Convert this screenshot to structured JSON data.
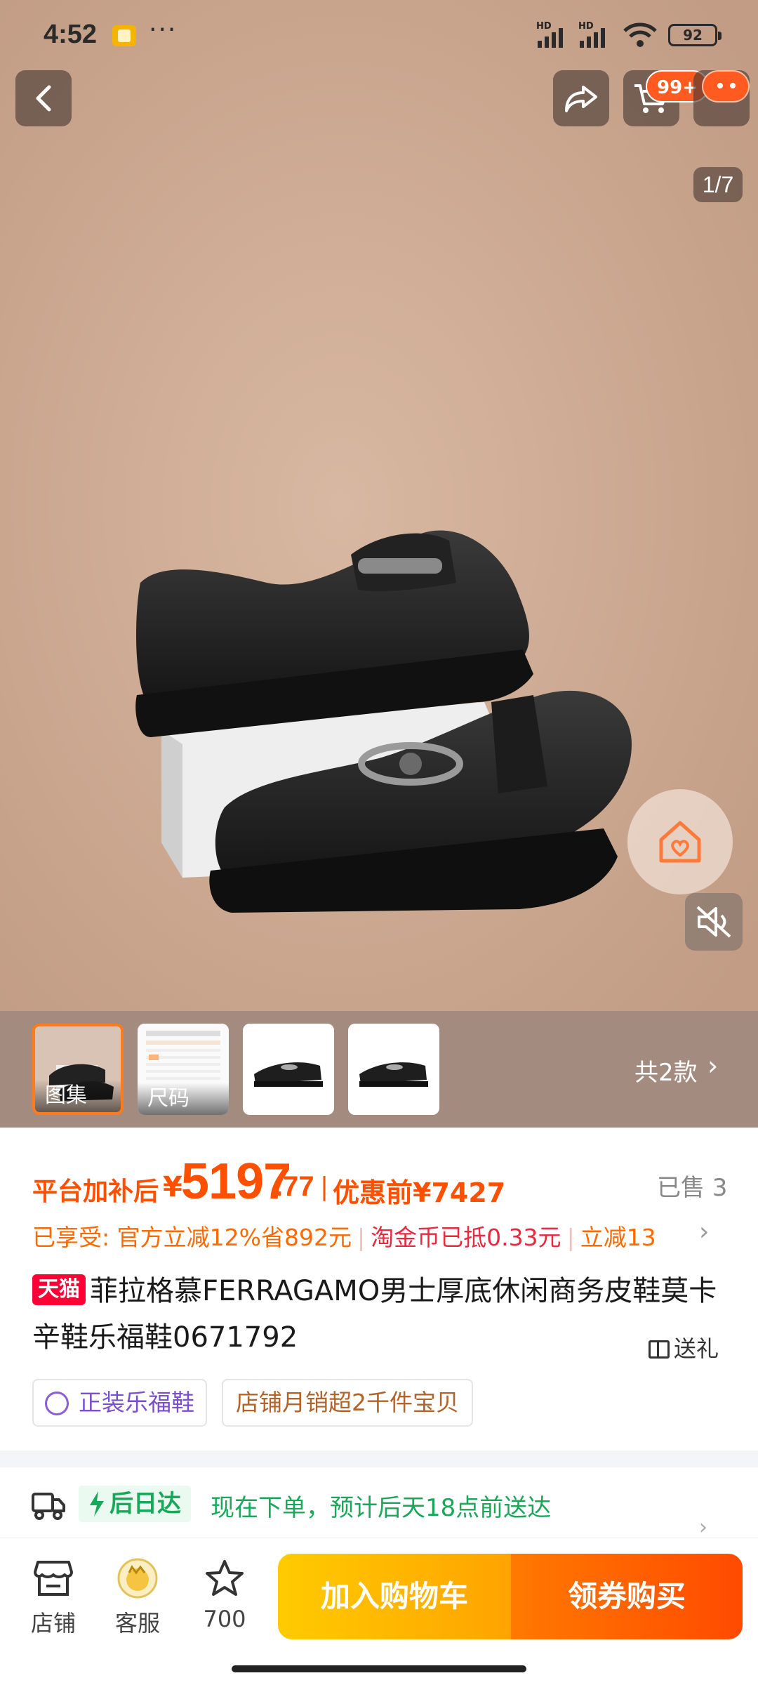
{
  "status_bar": {
    "time": "4:52",
    "more": "···",
    "battery": "92",
    "signal_label": "HD"
  },
  "nav": {
    "cart_badge": "99+",
    "page_indicator": "1/7"
  },
  "thumbs": [
    {
      "label": "图集"
    },
    {
      "label": "尺码"
    },
    {
      "label": ""
    },
    {
      "label": ""
    }
  ],
  "variants": {
    "label": "共2款"
  },
  "price": {
    "prefix": "平台加补后",
    "yen": "¥",
    "integer": "5197",
    "decimal": ".77",
    "separator": "|",
    "before": "优惠前¥7427",
    "sold": "已售 3"
  },
  "benefits": {
    "enjoyed": "已享受: 官方立减12%省892元",
    "coin": "淘金币已抵0.33元",
    "discount": "立减13"
  },
  "product": {
    "tag": "天猫",
    "title": "菲拉格慕FERRAGAMO男士厚底休闲商务皮鞋莫卡辛鞋乐福鞋0671792",
    "gift": "送礼"
  },
  "tags": {
    "authentic": "正装乐福鞋",
    "sales": "店铺月销超2千件宝贝"
  },
  "delivery": {
    "badge": "后日达",
    "text": "现在下单，预计后天18点前送达"
  },
  "bottom_bar": {
    "store": "店铺",
    "service": "客服",
    "favorites": "700",
    "add_to_cart": "加入购物车",
    "buy": "领券购买"
  },
  "colors": {
    "accent": "#ff5000",
    "tmall": "#ff0036",
    "delivery": "#19a85a",
    "cart_button": "#ffb000",
    "buy_button": "#ff5a00"
  }
}
